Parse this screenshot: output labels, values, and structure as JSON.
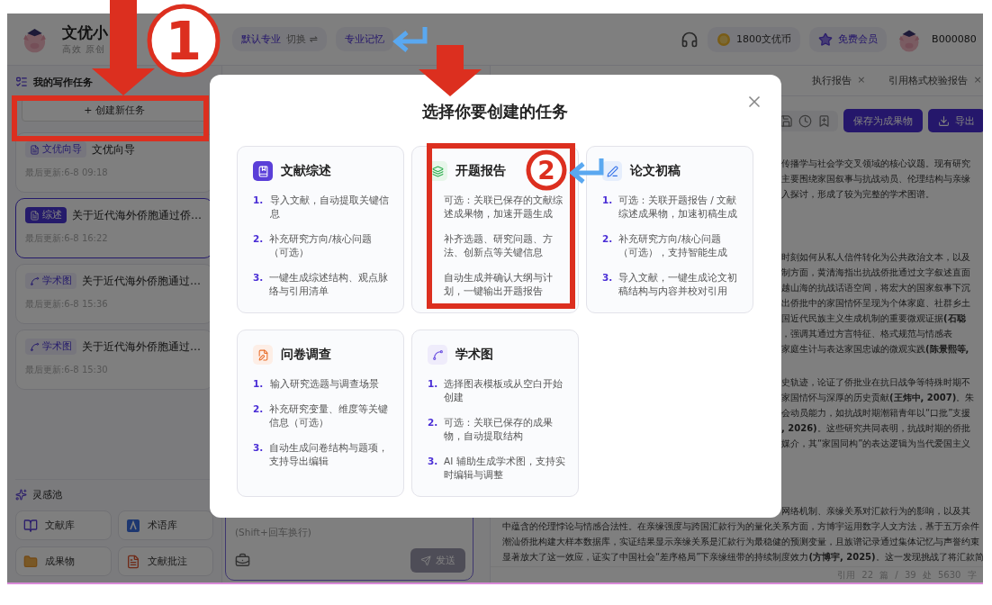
{
  "header": {
    "brand": "文优小",
    "slogan": "高效 原创",
    "major": "默认专业",
    "switch": "切换 ⇌",
    "memory": "专业记忆",
    "coins": "1800文优币",
    "membership": "免费会员",
    "user": "B000080"
  },
  "sidebar": {
    "title": "我的写作任务",
    "create_button": "+ 创建新任务",
    "tasks": [
      {
        "tag": "文优向导",
        "kind": "guide",
        "title": "文优向导",
        "updated": "最后更新:6-8 09:18",
        "selected": false
      },
      {
        "tag": "综述",
        "kind": "guide",
        "title": "关于近代海外侨胞通过侨…",
        "updated": "最后更新:6-8 16:22",
        "selected": true
      },
      {
        "tag": "学术图",
        "kind": "chart",
        "title": "关于近代海外侨胞通过…",
        "updated": "最后更新:6-8 15:36",
        "selected": false
      },
      {
        "tag": "学术图",
        "kind": "chart",
        "title": "关于近代海外侨胞通过…",
        "updated": "最后更新:6-8 15:30",
        "selected": false
      }
    ],
    "inspiration": {
      "title": "灵感池",
      "items": [
        {
          "label": "文献库",
          "kind": "library"
        },
        {
          "label": "术语库",
          "kind": "terms"
        },
        {
          "label": "成果物",
          "kind": "results"
        },
        {
          "label": "文献批注",
          "kind": "notes"
        }
      ]
    }
  },
  "chat": {
    "hint": "(Shift+回车换行)",
    "send": "发送"
  },
  "editor": {
    "tabs": [
      {
        "label": "执行报告",
        "close": "×"
      },
      {
        "label": "引用格式校验报告",
        "close": "×"
      }
    ],
    "save_button": "保存为成果物",
    "export_button": "导出",
    "paragraphs": [
      {
        "lines": [
          {
            "kind": "partial",
            "text": "传播学与社会学交叉领域的核心议题。现有研究"
          },
          {
            "kind": "partial",
            "text": "主要围绕家国叙事与抗战动员、伦理结构与亲缘"
          },
          {
            "kind": "partial",
            "text": "入探讨，形成了较为完整的学术图谱。"
          }
        ]
      },
      {
        "lines": [
          {
            "kind": "partial",
            "text": "时刻如何从私人信件转化为公共政治文本，以及"
          },
          {
            "kind": "partial",
            "text": "制方面，黄清海指出抗战侨批通过文字叙述直面"
          },
          {
            "kind": "partial",
            "text": "越山海的抗战话语空间，将宏大的国家叙事下沉"
          },
          {
            "kind": "partial",
            "text": "出侨批中的家国情怀呈现为个体家庭、社群乡土"
          },
          {
            "kind": "partial",
            "text": "国近代民族主义生成机制的重要微观证据**(石聪**"
          },
          {
            "kind": "partial",
            "text": "，强调其通过方言特征、格式规范与情感表"
          },
          {
            "kind": "partial",
            "text": "家庭生计与表达家国忠诚的微观实践**(陈景熙等,**"
          }
        ]
      },
      {
        "lines": [
          {
            "kind": "partial",
            "text": "史轨迹，论证了侨批业在抗日战争等特殊时期不"
          },
          {
            "kind": "partial",
            "text": "家国情怀与深厚的历史贡献**(王炜中, 2007)**。朱"
          },
          {
            "kind": "partial",
            "text": "会动员能力，如抗战时期潮籍青年以“口批”支援"
          },
          {
            "kind": "partial",
            "text": "**, 2026)**。这些研究共同表明，抗战时期的侨批"
          },
          {
            "kind": "partial",
            "text": "媒介，其“家国同构”的表达逻辑为当代爱国主义"
          }
        ]
      },
      {
        "lines": [
          {
            "kind": "partial",
            "text": "网络机制、亲缘关系对汇款行为的影响，以及其"
          },
          {
            "kind": "full",
            "text": "中蕴含的伦理悖论与情感合法性。在亲缘强度与跨国汇款行为的量化关系方面，方博宇运用数字人文方法，基于五万余件"
          },
          {
            "kind": "full",
            "text": "潮汕侨批构建大样本数据库，实证结果显示亲缘关系是汇款行为最稳健的预测变量，且族谱记录通过集体记忆与声誉约束"
          },
          {
            "kind": "full",
            "text": "显著放大了这一效应，证实了中国社会“差序格局”下亲缘纽带的持续制度效力**(方博宇, 2025)**。这一发现挑战了将汇款简"
          }
        ]
      }
    ],
    "status": "引用 22 篇 / 39 处   5630 字"
  },
  "dialog": {
    "title": "选择你要创建的任务",
    "cards": [
      {
        "kind": "review",
        "title": "文献综述",
        "steps": [
          {
            "number": "1.",
            "text": "导入文献，自动提取关键信息"
          },
          {
            "number": "2.",
            "text": "补充研究方向/核心问题（可选）"
          },
          {
            "number": "3.",
            "text": "一键生成综述结构、观点脉络与引用清单"
          }
        ]
      },
      {
        "kind": "proposal",
        "title": "开题报告",
        "steps": [
          {
            "text": "可选：关联已保存的文献综述成果物，加速开题生成"
          },
          {
            "text": "补齐选题、研究问题、方法、创新点等关键信息"
          },
          {
            "text": "自动生成并确认大纲与计划，一键输出开题报告"
          }
        ]
      },
      {
        "kind": "draft",
        "title": "论文初稿",
        "steps": [
          {
            "number": "1.",
            "text": "可选：关联开题报告 / 文献综述成果物，加速初稿生成"
          },
          {
            "number": "2.",
            "text": "补充研究方向/核心问题（可选），支持智能生成"
          },
          {
            "number": "3.",
            "text": "导入文献，一键生成论文初稿结构与内容并校对引用"
          }
        ]
      },
      {
        "kind": "survey",
        "title": "问卷调查",
        "steps": [
          {
            "number": "1.",
            "text": "输入研究选题与调查场景"
          },
          {
            "number": "2.",
            "text": "补充研究变量、维度等关键信息（可选）"
          },
          {
            "number": "3.",
            "text": "自动生成问卷结构与题项，支持导出编辑"
          }
        ]
      },
      {
        "kind": "chart",
        "title": "学术图",
        "steps": [
          {
            "number": "1.",
            "text": "选择图表模板或从空白开始创建"
          },
          {
            "number": "2.",
            "text": "可选：关联已保存的成果物，自动提取结构"
          },
          {
            "number": "3.",
            "text": "AI 辅助生成学术图，支持实时编辑与调整"
          }
        ]
      }
    ]
  },
  "annotations": [
    {
      "number": "1"
    },
    {
      "number": "2"
    }
  ]
}
